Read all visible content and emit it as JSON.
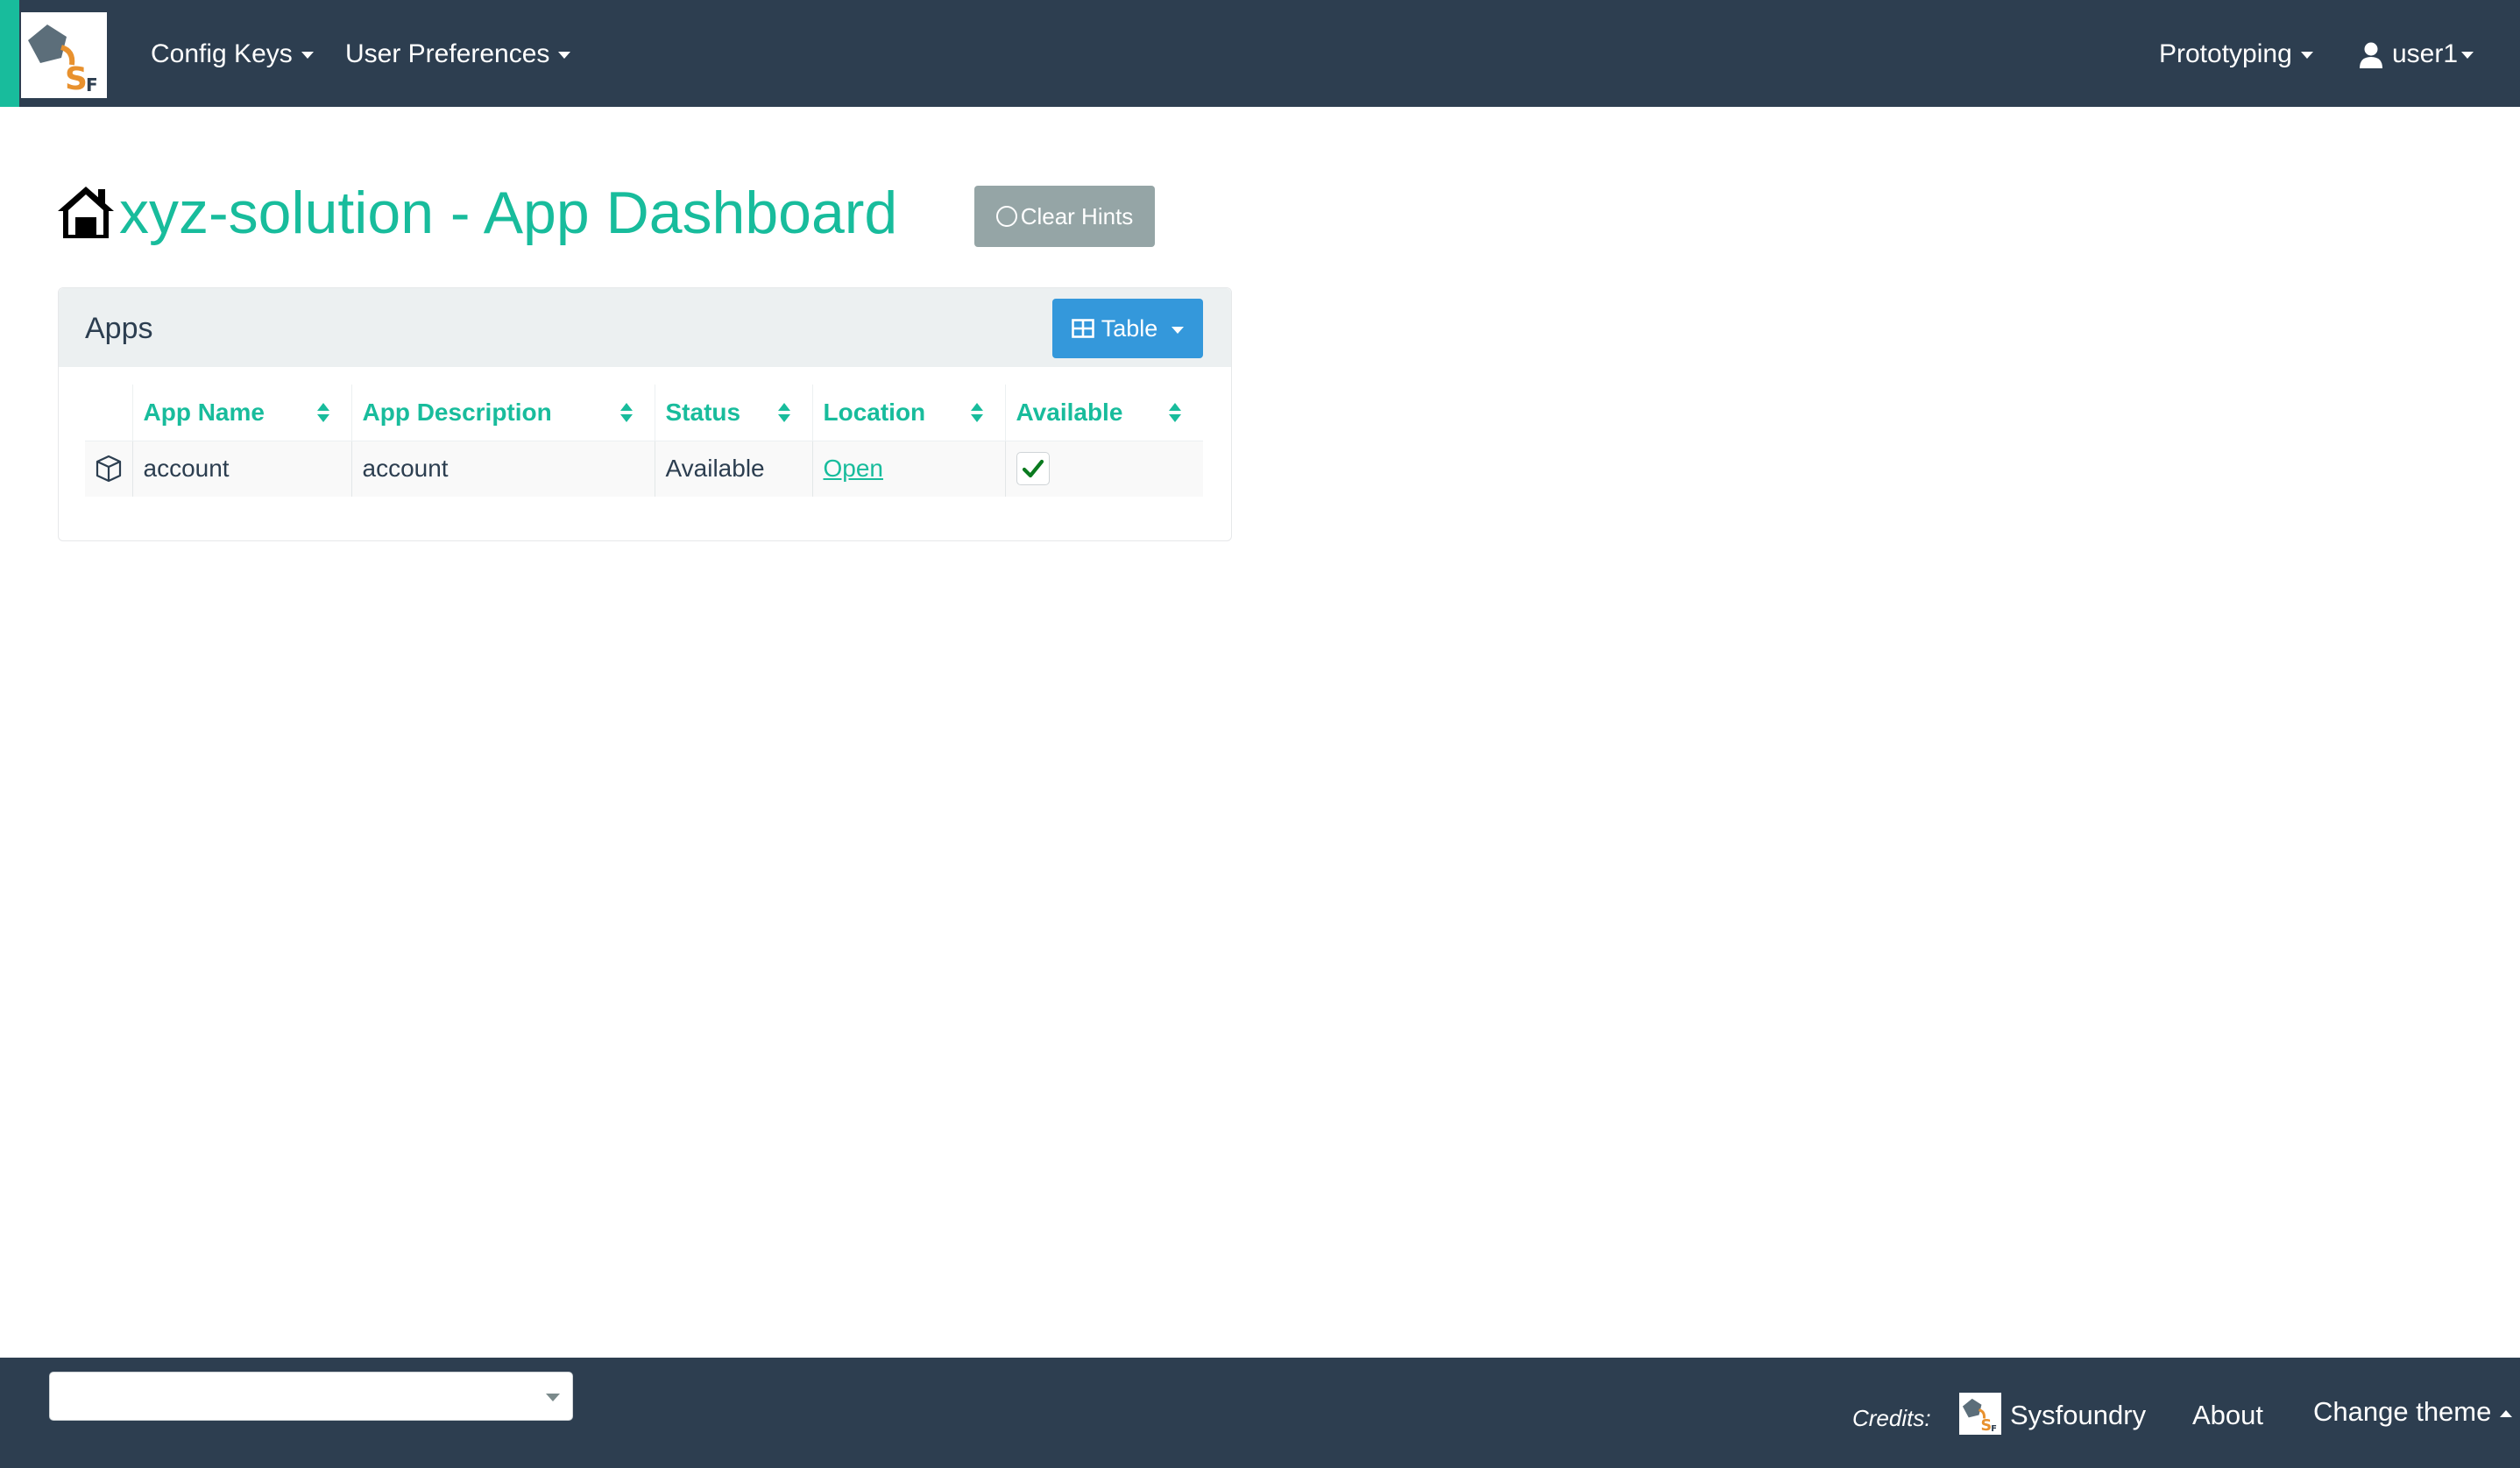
{
  "navbar": {
    "brand_icon": "sysfoundry-logo",
    "menus": [
      {
        "label": "Config Keys"
      },
      {
        "label": "User Preferences"
      }
    ],
    "right_menus": [
      {
        "label": "Prototyping"
      },
      {
        "label": "user1",
        "icon": "user-icon"
      }
    ],
    "accent_color": "#18bc9c",
    "background_color": "#2d3e50"
  },
  "header": {
    "icon": "home-icon",
    "title": "xyz-solution - App Dashboard",
    "clear_hints_label": "Clear Hints"
  },
  "panel": {
    "title": "Apps",
    "view_button_label": "Table",
    "view_button_icon": "table-icon"
  },
  "table": {
    "columns": [
      "App Name",
      "App Description",
      "Status",
      "Location",
      "Available"
    ],
    "rows": [
      {
        "icon": "cube-icon",
        "app_name": "account",
        "app_description": "account",
        "status": "Available",
        "location": "Open",
        "available": true
      }
    ]
  },
  "footer": {
    "select_value": "",
    "credits_label": "Credits:",
    "credits_link": "Sysfoundry",
    "about_label": "About",
    "change_theme_label": "Change theme"
  }
}
